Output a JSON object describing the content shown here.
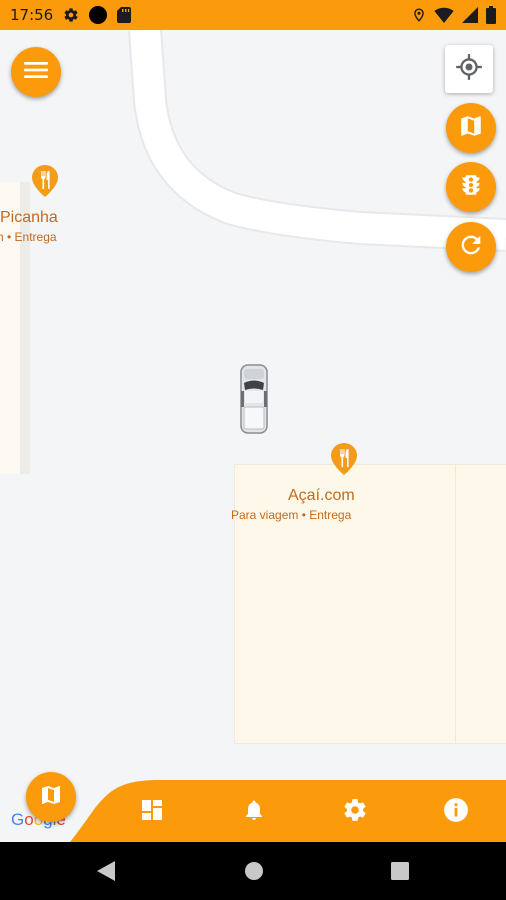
{
  "status_bar": {
    "time": "17:56",
    "icons_left": [
      "gear-icon",
      "circle-icon",
      "sd-card-icon"
    ],
    "icons_right": [
      "location-icon",
      "wifi-icon",
      "signal-icon",
      "battery-icon"
    ]
  },
  "map": {
    "pois": [
      {
        "name": "Picanha",
        "subtitle": "h • Entrega",
        "icon": "restaurant-icon"
      },
      {
        "name": "Açaí.com",
        "subtitle": "Para viagem • Entrega",
        "icon": "restaurant-icon"
      }
    ],
    "attribution": "Google",
    "vehicle": "car-icon"
  },
  "controls": {
    "menu": "menu-icon",
    "locate": "my-location-icon",
    "map_layers": "map-icon",
    "traffic": "traffic-light-icon",
    "refresh": "refresh-icon"
  },
  "bottom_nav": {
    "items": [
      "map-icon",
      "dashboard-icon",
      "bell-icon",
      "gear-icon",
      "info-icon"
    ]
  },
  "colors": {
    "accent": "#fb9a0b",
    "poi_text": "#c46a1e",
    "map_bg": "#f4f5f7"
  }
}
